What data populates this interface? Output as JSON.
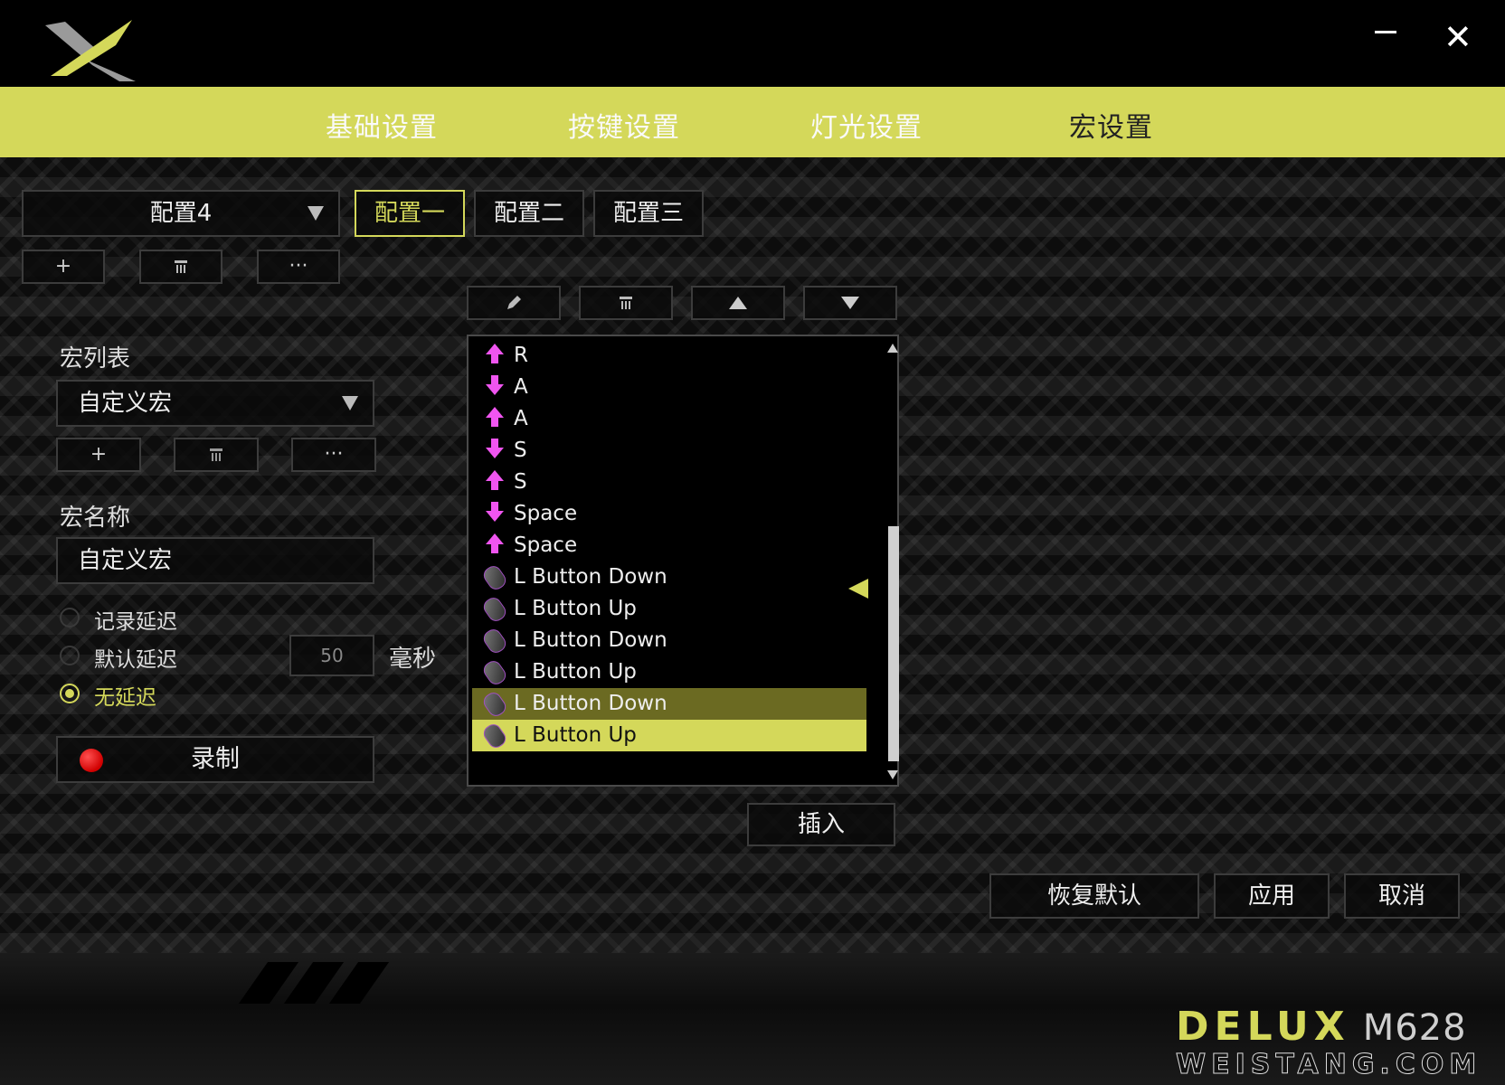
{
  "window": {
    "minimize_icon": "minimize-icon",
    "close_glyph": "✕"
  },
  "nav": {
    "tabs": [
      "基础设置",
      "按键设置",
      "灯光设置",
      "宏设置"
    ],
    "active": "宏设置"
  },
  "profile": {
    "selected": "配置4",
    "configs": [
      "配置一",
      "配置二",
      "配置三"
    ],
    "add": "+",
    "delete_icon": "trash-icon",
    "more": "···"
  },
  "macro_panel": {
    "list_title": "宏列表",
    "list_selected": "自定义宏",
    "add": "+",
    "more": "···",
    "name_title": "宏名称",
    "name_value": "自定义宏",
    "delay": {
      "options": [
        "记录延迟",
        "默认延迟",
        "无延迟"
      ],
      "selected": "无延迟",
      "default_value": "50",
      "unit": "毫秒"
    },
    "record": "录制"
  },
  "editor": {
    "toolbar_icons": [
      "edit-icon",
      "trash-icon",
      "move-up-icon",
      "move-down-icon"
    ],
    "events": [
      {
        "type": "key-up",
        "label": "R"
      },
      {
        "type": "key-down",
        "label": "A"
      },
      {
        "type": "key-up",
        "label": "A"
      },
      {
        "type": "key-down",
        "label": "S"
      },
      {
        "type": "key-up",
        "label": "S"
      },
      {
        "type": "key-down",
        "label": "Space"
      },
      {
        "type": "key-up",
        "label": "Space"
      },
      {
        "type": "mouse",
        "label": "L Button Down"
      },
      {
        "type": "mouse",
        "label": "L Button Up"
      },
      {
        "type": "mouse",
        "label": "L Button Down"
      },
      {
        "type": "mouse",
        "label": "L Button Up"
      },
      {
        "type": "mouse",
        "label": "L Button Down"
      },
      {
        "type": "mouse",
        "label": "L Button Up"
      }
    ],
    "insert": "插入"
  },
  "actions": {
    "restore": "恢复默认",
    "apply": "应用",
    "cancel": "取消"
  },
  "brand": {
    "name": "DELUX",
    "model": "M628",
    "watermark": "WEISTANG.COM"
  },
  "colors": {
    "accent": "#d4d85a",
    "key_arrow": "#f055f0",
    "record": "#e00000"
  }
}
